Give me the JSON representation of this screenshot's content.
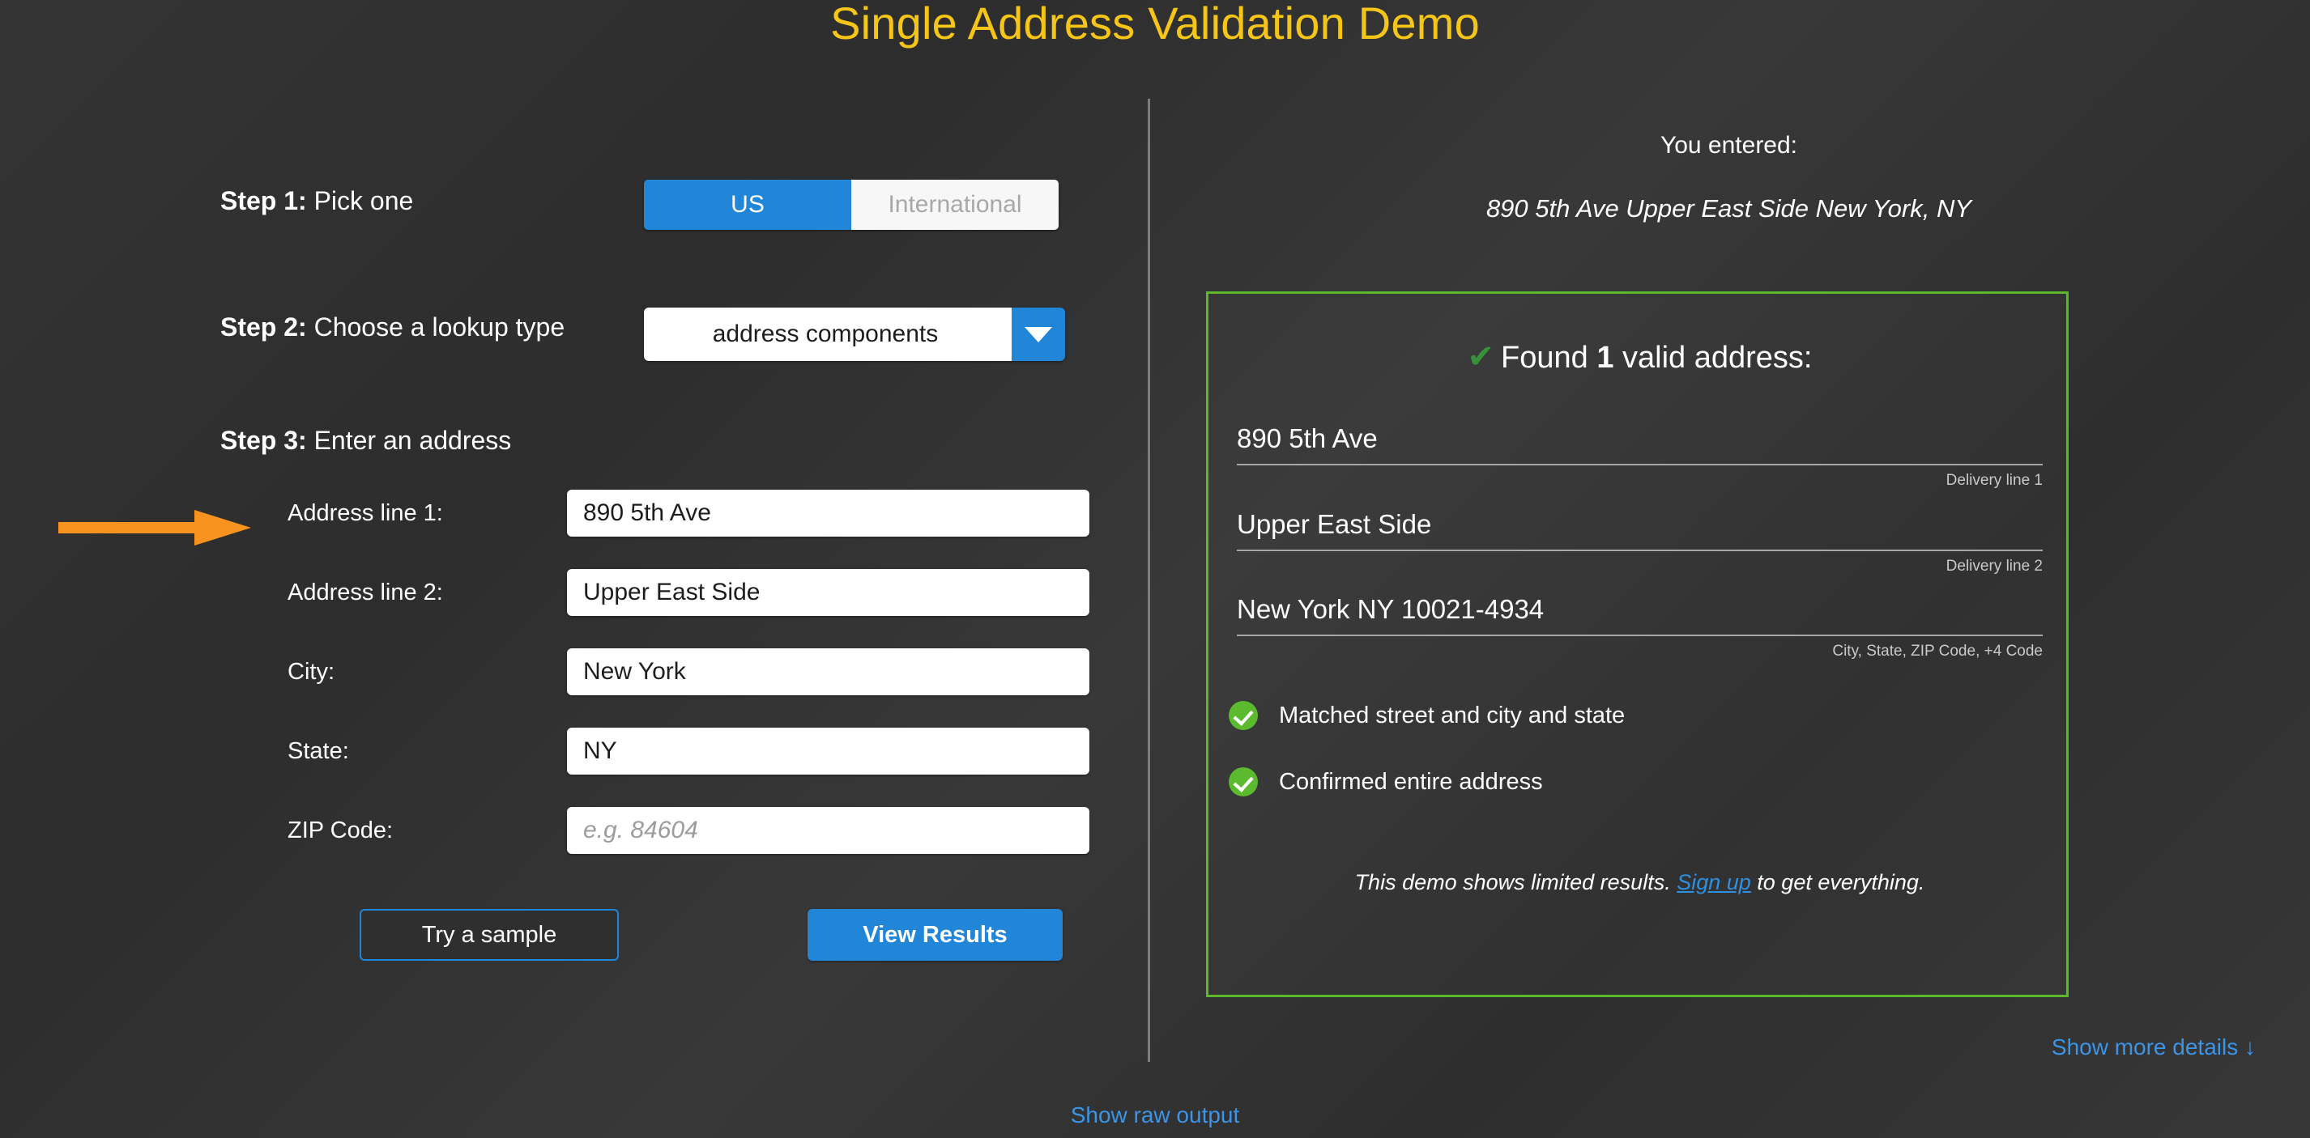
{
  "page": {
    "title": "Single Address Validation Demo",
    "title_color": "#f5c518",
    "background_color": "#313131",
    "accent_blue": "#2185d8",
    "accent_green": "#5cb82a",
    "accent_orange": "#f7931e",
    "link_blue": "#3a94e8"
  },
  "form": {
    "step1": {
      "number": "Step 1:",
      "text": " Pick one",
      "options": [
        {
          "label": "US",
          "selected": true
        },
        {
          "label": "International",
          "selected": false
        }
      ]
    },
    "step2": {
      "number": "Step 2:",
      "text": " Choose a lookup type",
      "selected_value": "address components",
      "caret_icon": "chevron-down-icon"
    },
    "step3": {
      "number": "Step 3:",
      "text": " Enter an address",
      "pointer_icon": "arrow-right-icon",
      "fields": [
        {
          "label": "Address line 1:",
          "value": "890 5th Ave",
          "placeholder": ""
        },
        {
          "label": "Address line 2:",
          "value": "Upper East Side",
          "placeholder": ""
        },
        {
          "label": "City:",
          "value": "New York",
          "placeholder": ""
        },
        {
          "label": "State:",
          "value": "NY",
          "placeholder": ""
        },
        {
          "label": "ZIP Code:",
          "value": "",
          "placeholder": "e.g. 84604"
        }
      ]
    },
    "buttons": {
      "sample": "Try a sample",
      "results": "View Results"
    }
  },
  "results": {
    "you_entered_label": "You entered:",
    "you_entered_value": "890 5th Ave Upper East Side New York, NY",
    "found": {
      "check_icon": "check-icon",
      "prefix": "Found ",
      "count": "1",
      "suffix": " valid address:"
    },
    "address_lines": [
      {
        "value": "890 5th Ave",
        "caption": "Delivery line 1"
      },
      {
        "value": "Upper East Side",
        "caption": "Delivery line 2"
      },
      {
        "value": "New York NY 10021-4934",
        "caption": "City, State, ZIP Code, +4 Code"
      }
    ],
    "statuses": [
      {
        "icon": "check-circle-icon",
        "text": "Matched street and city and state"
      },
      {
        "icon": "check-circle-icon",
        "text": "Confirmed entire address"
      }
    ],
    "demo_note": {
      "before": "This demo shows limited results. ",
      "link": "Sign up",
      "after": " to get everything."
    },
    "show_more_details": "Show more details ↓"
  },
  "footer": {
    "show_raw_output": "Show raw output"
  }
}
